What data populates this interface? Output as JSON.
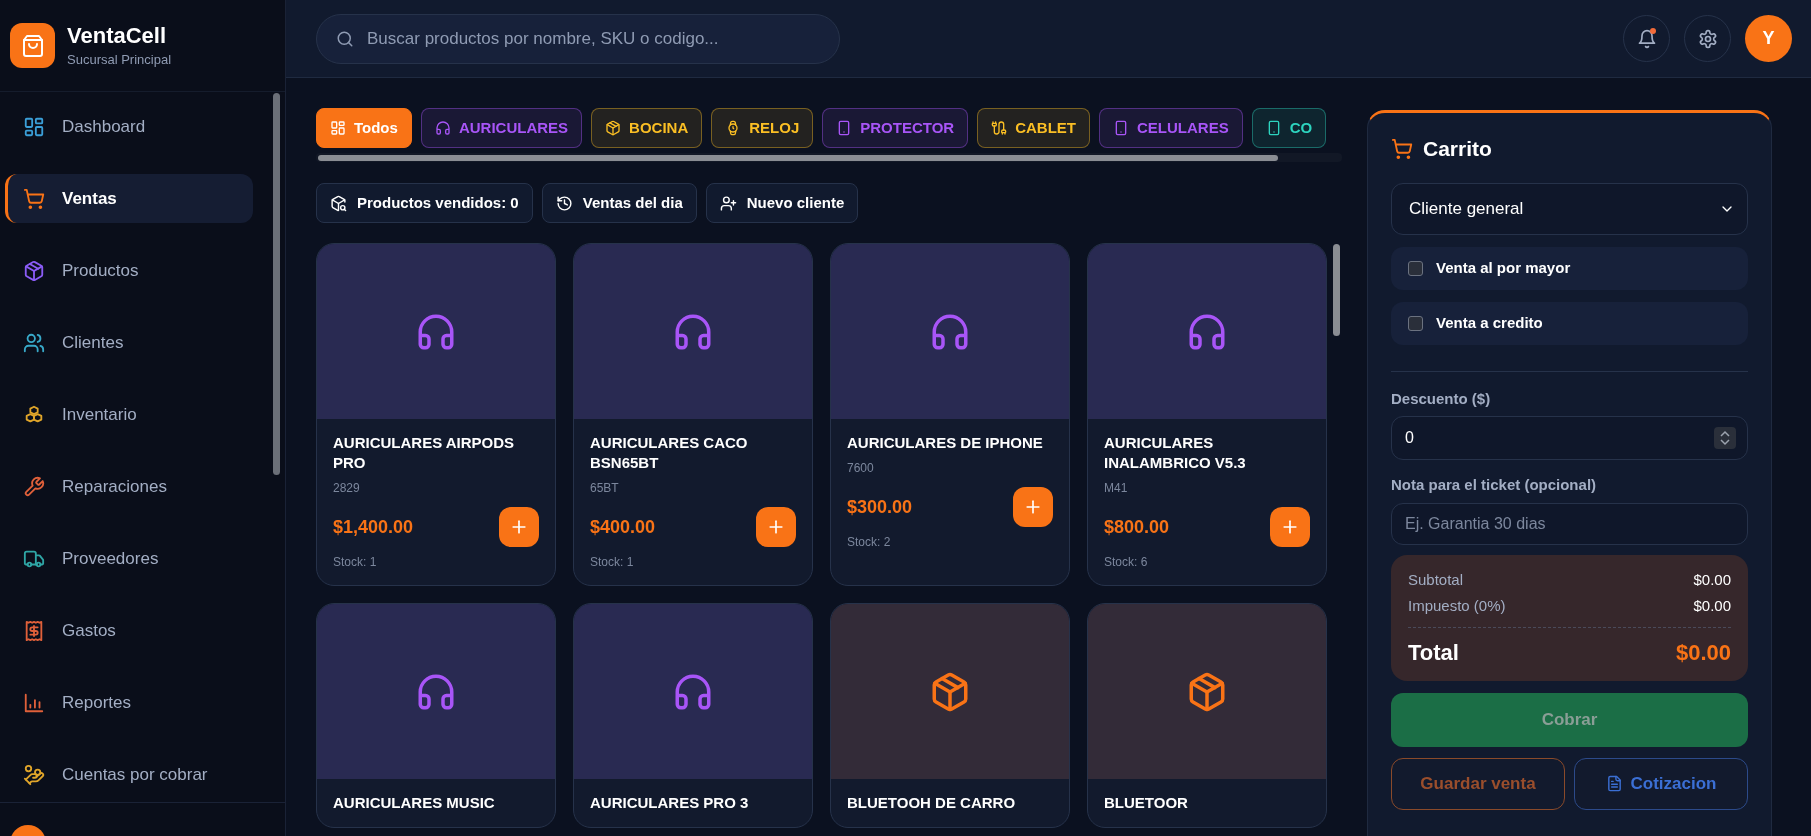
{
  "app": {
    "name": "VentaCell",
    "branch": "Sucursal Principal"
  },
  "sidebar": {
    "items": [
      {
        "label": "Dashboard",
        "kind": "grid",
        "color": "#3b9fd8",
        "selected": false
      },
      {
        "label": "Ventas",
        "kind": "cart",
        "color": "#f97316",
        "selected": true
      },
      {
        "label": "Productos",
        "kind": "box",
        "color": "#8b5cf6",
        "selected": false
      },
      {
        "label": "Clientes",
        "kind": "users",
        "color": "#38a9c9",
        "selected": false
      },
      {
        "label": "Inventario",
        "kind": "boxes",
        "color": "#e0a52a",
        "selected": false
      },
      {
        "label": "Reparaciones",
        "kind": "wrench",
        "color": "#e0603a",
        "selected": false
      },
      {
        "label": "Proveedores",
        "kind": "truck",
        "color": "#2fa6a6",
        "selected": false
      },
      {
        "label": "Gastos",
        "kind": "receipt",
        "color": "#e0603a",
        "selected": false
      },
      {
        "label": "Reportes",
        "kind": "chart",
        "color": "#e0603a",
        "selected": false
      },
      {
        "label": "Cuentas por cobrar",
        "kind": "hand-coins",
        "color": "#e0a52a",
        "selected": false
      }
    ]
  },
  "search": {
    "placeholder": "Buscar productos por nombre, SKU o codigo..."
  },
  "header": {
    "notification_dot": true,
    "avatar": "Y"
  },
  "categories": [
    {
      "label": "Todos",
      "kind": "grid",
      "color": "#f97316",
      "selected": true
    },
    {
      "label": "AURICULARES",
      "kind": "headphones",
      "color": "#a855f7",
      "selected": false
    },
    {
      "label": "BOCINA",
      "kind": "box",
      "color": "#fbbf24",
      "selected": false
    },
    {
      "label": "RELOJ",
      "kind": "watch",
      "color": "#fbbf24",
      "selected": false
    },
    {
      "label": "PROTECTOR",
      "kind": "phone",
      "color": "#a855f7",
      "selected": false
    },
    {
      "label": "CABLET",
      "kind": "cable",
      "color": "#fbbf24",
      "selected": false
    },
    {
      "label": "CELULARES",
      "kind": "phone",
      "color": "#a855f7",
      "selected": false
    },
    {
      "label": "CO",
      "kind": "phone",
      "color": "#2dd4bf",
      "selected": false
    }
  ],
  "actions": [
    {
      "label": "Productos vendidos: 0",
      "kind": "box-search"
    },
    {
      "label": "Ventas del dia",
      "kind": "history"
    },
    {
      "label": "Nuevo cliente",
      "kind": "user-plus"
    }
  ],
  "products": [
    {
      "name": "AURICULARES AIRPODS PRO",
      "code": "2829",
      "price": "$1,400.00",
      "stock": "Stock: 1",
      "kind": "headphones"
    },
    {
      "name": "AURICULARES CACO BSN65BT",
      "code": "65BT",
      "price": "$400.00",
      "stock": "Stock: 1",
      "kind": "headphones"
    },
    {
      "name": "AURICULARES DE IPHONE",
      "code": "7600",
      "price": "$300.00",
      "stock": "Stock: 2",
      "kind": "headphones"
    },
    {
      "name": "AURICULARES INALAMBRICO V5.3",
      "code": "M41",
      "price": "$800.00",
      "stock": "Stock: 6",
      "kind": "headphones"
    },
    {
      "name": "AURICULARES MUSIC",
      "kind": "headphones"
    },
    {
      "name": "AURICULARES PRO 3",
      "kind": "headphones"
    },
    {
      "name": "BLUETOOH DE CARRO",
      "kind": "box"
    },
    {
      "name": "BLUETOOR",
      "kind": "box"
    }
  ],
  "cart": {
    "title": "Carrito",
    "customer": "Cliente general",
    "options": [
      {
        "label": "Venta al por mayor",
        "checked": false
      },
      {
        "label": "Venta a credito",
        "checked": false
      }
    ],
    "discount": {
      "label": "Descuento ($)",
      "value": "0"
    },
    "note": {
      "label": "Nota para el ticket (opcional)",
      "placeholder": "Ej. Garantia 30 dias"
    },
    "summary": [
      {
        "label": "Subtotal",
        "value": "$0.00"
      },
      {
        "label": "Impuesto (0%)",
        "value": "$0.00"
      }
    ],
    "total": {
      "label": "Total",
      "value": "$0.00"
    },
    "buttons": [
      {
        "label": "Cobrar",
        "kind": "primary",
        "disabled": true
      },
      {
        "label": "Guardar venta",
        "kind": "save",
        "disabled": true
      },
      {
        "label": "Cotizacion",
        "kind": "quote",
        "disabled": false
      }
    ]
  }
}
